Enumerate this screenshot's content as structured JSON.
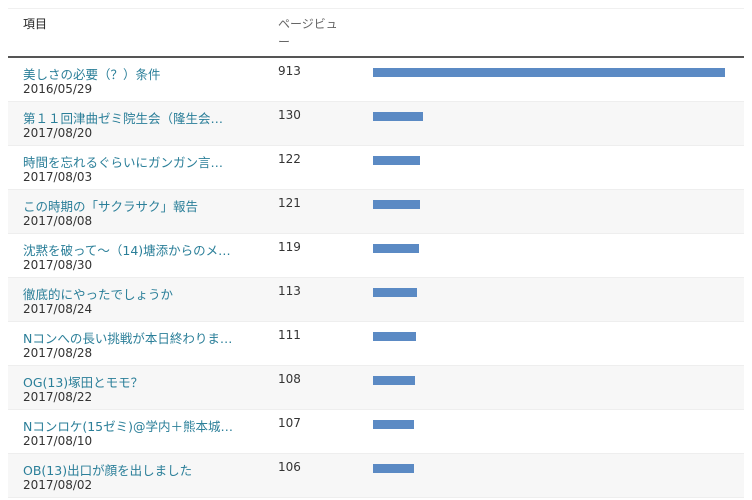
{
  "header": {
    "item_label": "項目",
    "views_label": "ページビュー"
  },
  "bar_color": "#5b8ac4",
  "link_color": "#2b7f99",
  "chart_data": {
    "type": "bar",
    "categories": [
      "美しさの必要（？）条件",
      "第１１回津曲ゼミ院生会（隆生会…",
      "時間を忘れるぐらいにガンガン言…",
      "この時期の「サクラサク」報告",
      "沈黙を破って～（14)塘添からのメ…",
      "徹底的にやったでしょうか",
      "Nコンへの長い挑戦が本日終わりま…",
      "OG(13)塚田とモモ？",
      "Nコンロケ(15ゼミ)@学内＋熊本城…",
      "OB(13)出口が顔を出しました"
    ],
    "values": [
      913,
      130,
      122,
      121,
      119,
      113,
      111,
      108,
      107,
      106
    ],
    "xlabel": "",
    "ylabel": "",
    "ylim": [
      0,
      913
    ]
  },
  "rows": [
    {
      "title": "美しさの必要（？）条件",
      "date": "2016/05/29",
      "views": "913"
    },
    {
      "title": "第１１回津曲ゼミ院生会（隆生会…",
      "date": "2017/08/20",
      "views": "130"
    },
    {
      "title": "時間を忘れるぐらいにガンガン言…",
      "date": "2017/08/03",
      "views": "122"
    },
    {
      "title": "この時期の「サクラサク」報告",
      "date": "2017/08/08",
      "views": "121"
    },
    {
      "title": "沈黙を破って～（14)塘添からのメ…",
      "date": "2017/08/30",
      "views": "119"
    },
    {
      "title": "徹底的にやったでしょうか",
      "date": "2017/08/24",
      "views": "113"
    },
    {
      "title": "Nコンへの長い挑戦が本日終わりま…",
      "date": "2017/08/28",
      "views": "111"
    },
    {
      "title": "OG(13)塚田とモモ？",
      "date": "2017/08/22",
      "views": "108"
    },
    {
      "title": "Nコンロケ(15ゼミ)@学内＋熊本城…",
      "date": "2017/08/10",
      "views": "107"
    },
    {
      "title": "OB(13)出口が顔を出しました",
      "date": "2017/08/02",
      "views": "106"
    }
  ]
}
